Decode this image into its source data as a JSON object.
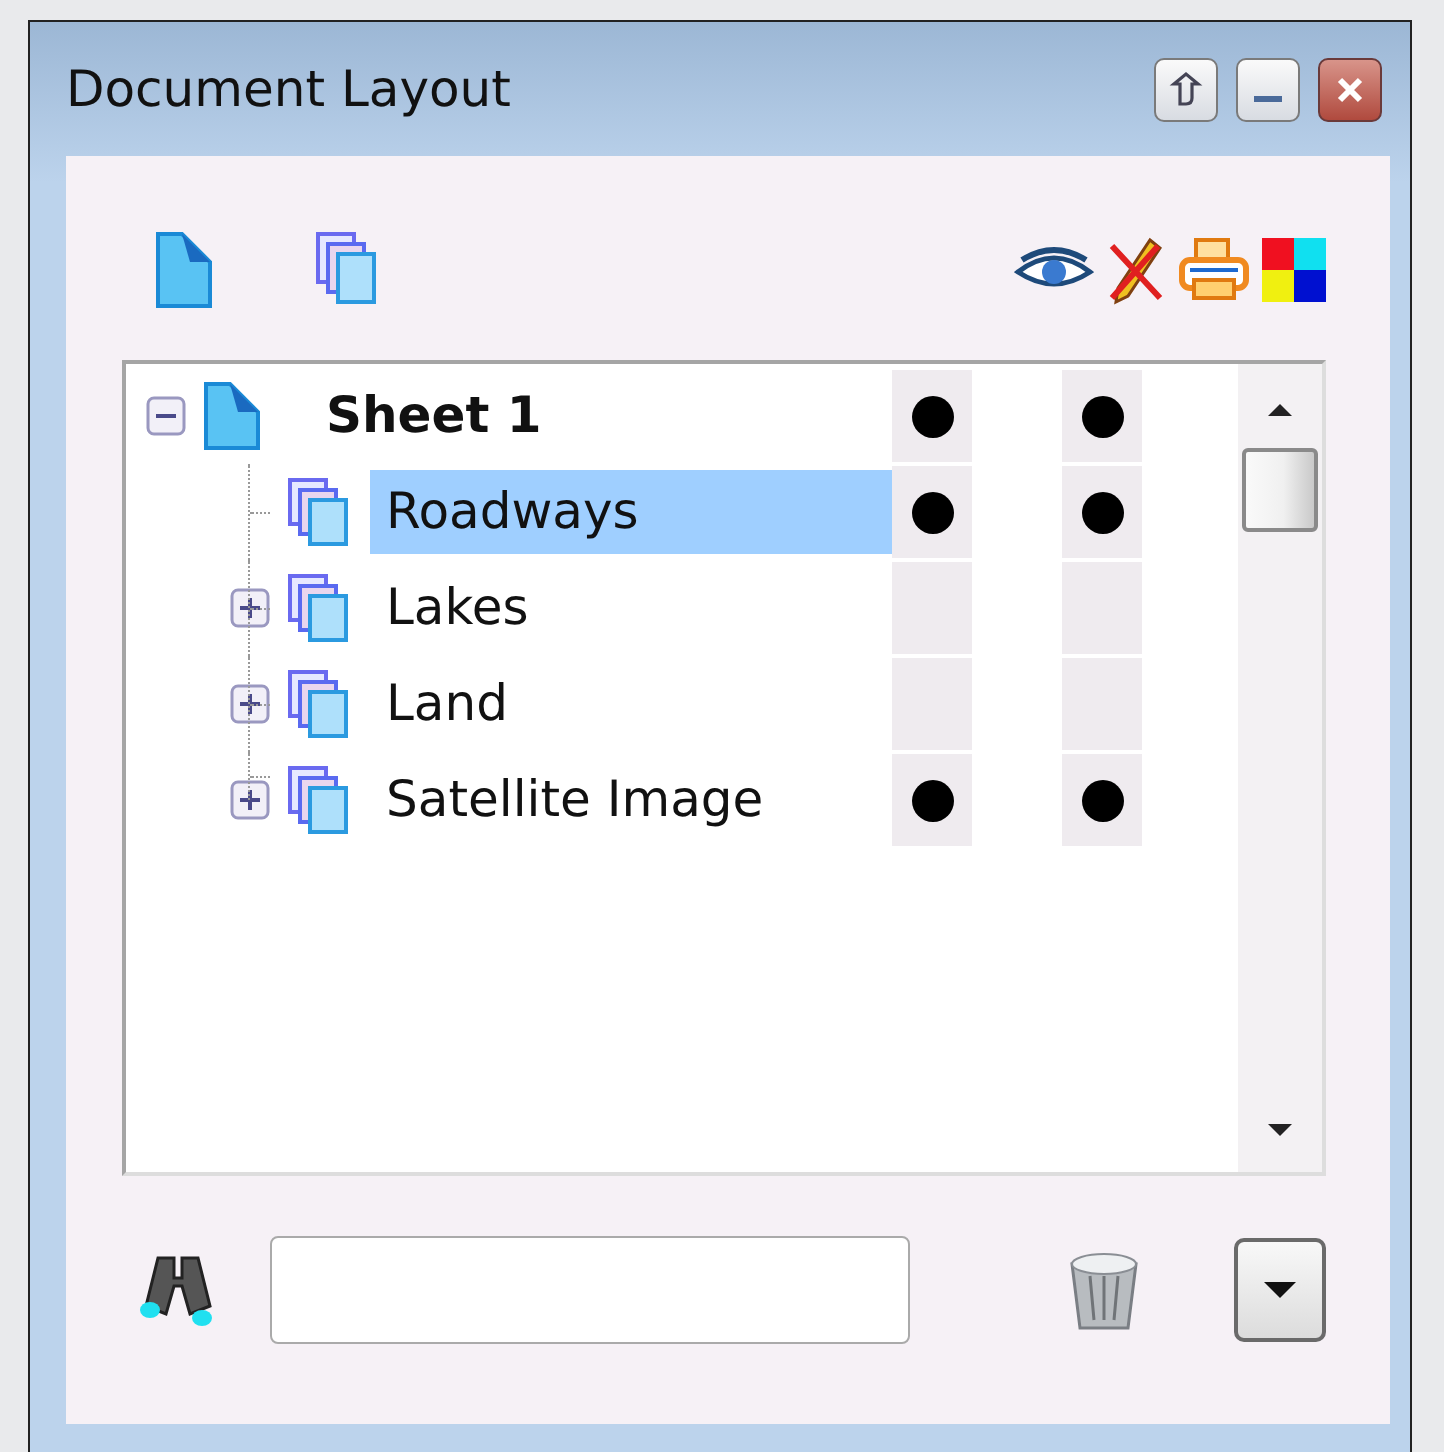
{
  "window": {
    "title": "Document Layout"
  },
  "tree": [
    {
      "label": "Sheet 1",
      "kind": "sheet",
      "expanded": true,
      "selected": false,
      "visible": true,
      "printable": true,
      "children": [
        {
          "label": "Roadways",
          "kind": "layer",
          "selected": true,
          "visible": true,
          "printable": true
        },
        {
          "label": "Lakes",
          "kind": "layer",
          "expanded": false,
          "selected": false,
          "visible": false,
          "printable": false
        },
        {
          "label": "Land",
          "kind": "layer",
          "expanded": false,
          "selected": false,
          "visible": false,
          "printable": false
        },
        {
          "label": "Satellite Image",
          "kind": "layer",
          "expanded": false,
          "selected": false,
          "visible": true,
          "printable": true
        }
      ]
    }
  ]
}
